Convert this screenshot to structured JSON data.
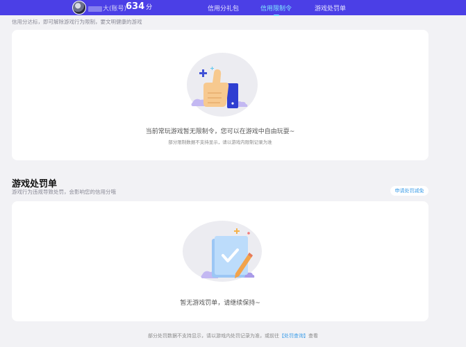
{
  "header": {
    "username": "大(账号)",
    "score": "634",
    "score_unit": "分",
    "tabs": [
      {
        "label": "信用分礼包",
        "active": false
      },
      {
        "label": "信用限制令",
        "active": true
      },
      {
        "label": "游戏处罚单",
        "active": false
      }
    ]
  },
  "restriction": {
    "subtitle": "信用分达标，即可解除游戏行为限制，要文明健康的游戏",
    "empty_main": "当前常玩游戏暂无限制令，您可以在游戏中自由玩耍~",
    "empty_sub": "部分限制数据不支持显示，请以游戏内限制记录为准"
  },
  "penalty": {
    "title": "游戏处罚单",
    "subtitle": "游戏行为违规导致处罚，会影响您的信用分哦",
    "apply_label": "申请处罚减免",
    "empty_main": "暂无游戏罚单，请继续保持~"
  },
  "footer": {
    "text_before": "部分处罚数据不支持显示，请以游戏内处罚记录为准，或前往",
    "link_label": "【处罚查询】",
    "text_after": "查看"
  },
  "colors": {
    "topbar": "#4b3fe6",
    "active_tab": "#7fe7ff",
    "link": "#3a9ce8",
    "background": "#f2f2f5"
  }
}
